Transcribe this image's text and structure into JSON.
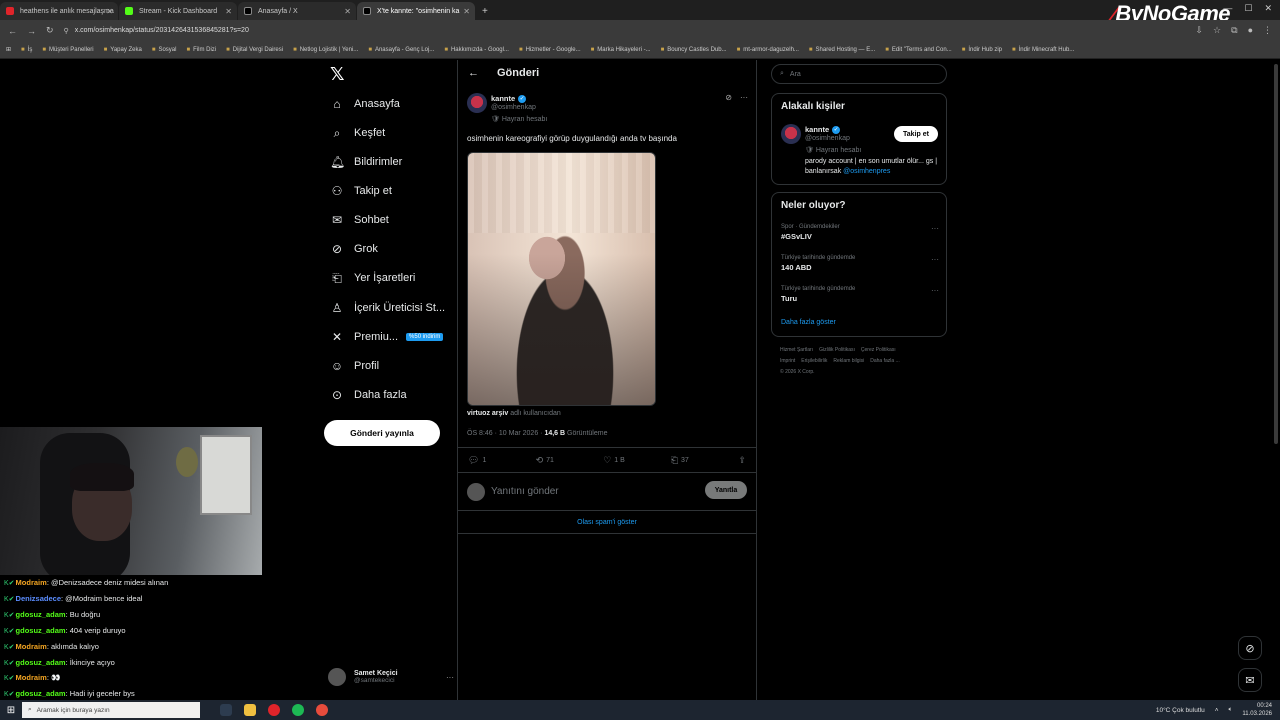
{
  "browser": {
    "tabs": [
      {
        "label": "heathens ile anlık mesajlaşma",
        "color": "#e0242a",
        "active": false
      },
      {
        "label": "Stream - Kick Dashboard",
        "color": "#53fc18",
        "active": false
      },
      {
        "label": "Anasayfa / X",
        "color": "#ffffff",
        "active": false
      },
      {
        "label": "X'te kannte: \"osimhenin ka",
        "color": "#ffffff",
        "active": true
      }
    ],
    "url": "x.com/osimhenkap/status/2031426431536845281?s=20",
    "bookmarks": [
      "İş",
      "Müşteri Panelleri",
      "Yapay Zeka",
      "Sosyal",
      "Film Dizi",
      "Dijital Vergi Dairesi",
      "Netlog Lojistik | Yeni...",
      "Anasayfa - Genç Loj...",
      "Hakkımızda - Googl...",
      "Hizmetler - Google...",
      "Marka Hikayeleri -...",
      "Bouncy Castles Dub...",
      "mt-armor-daguzelh...",
      "Shared Hosting — E...",
      "Edit \"Terms and Con...",
      "İndir Hub zip",
      "İndir Minecraft Hub..."
    ],
    "brand": {
      "prefix": "By",
      "suffix": "NoGame"
    }
  },
  "nav": {
    "items": [
      {
        "label": "Anasayfa",
        "icon": "home-icon",
        "glyph": "⌂"
      },
      {
        "label": "Keşfet",
        "icon": "search-icon",
        "glyph": "⌕"
      },
      {
        "label": "Bildirimler",
        "icon": "bell-icon",
        "glyph": "🔔︎"
      },
      {
        "label": "Takip et",
        "icon": "person-add-icon",
        "glyph": "⚇"
      },
      {
        "label": "Sohbet",
        "icon": "mail-icon",
        "glyph": "✉"
      },
      {
        "label": "Grok",
        "icon": "grok-icon",
        "glyph": "⊘"
      },
      {
        "label": "Yer İşaretleri",
        "icon": "bookmark-icon",
        "glyph": "⎗"
      },
      {
        "label": "İçerik Üreticisi St...",
        "icon": "creator-icon",
        "glyph": "♙"
      },
      {
        "label": "Premiu...",
        "icon": "x-icon",
        "glyph": "✕"
      },
      {
        "label": "Profil",
        "icon": "profile-icon",
        "glyph": "☺"
      },
      {
        "label": "Daha fazla",
        "icon": "more-icon",
        "glyph": "⊙"
      }
    ],
    "premium_badge": "%50 indirim",
    "post_button": "Gönderi yayınla",
    "account": {
      "name": "Samet Keçici",
      "handle": "@samtekecici"
    }
  },
  "post": {
    "header": "Gönderi",
    "author": {
      "name": "kannte",
      "handle": "@osimhenkap",
      "label": "Hayran hesabı"
    },
    "text": "osimhenin kareografiyi görüp duygulandığı anda tv başında",
    "source": {
      "name": "virtuoz arşiv",
      "suffix": "adlı kullanıcıdan"
    },
    "meta": {
      "time": "ÖS 8:46 · 10 Mar 2026 · ",
      "views": "14,6 B",
      "views_label": " Görüntüleme"
    },
    "actions": {
      "replies": "1",
      "reposts": "71",
      "likes": "1 B",
      "bookmarks": "37"
    },
    "reply_placeholder": "Yanıtını gönder",
    "reply_button": "Yanıtla",
    "spam_link": "Olası spam'i göster"
  },
  "sidebar": {
    "search_placeholder": "Ara",
    "related": {
      "title": "Alakalı kişiler",
      "name": "kannte",
      "handle": "@osimhenkap",
      "label": "Hayran hesabı",
      "bio": "parody account | en son umutlar ölür... gs | banlanırsak ",
      "mention": "@osimhenpres",
      "follow": "Takip et"
    },
    "trends": {
      "title": "Neler oluyor?",
      "items": [
        {
          "context": "Spor · Gündemdekiler",
          "topic": "#GSvLIV"
        },
        {
          "context": "Türkiye tarihinde gündemde",
          "topic": "140 ABD"
        },
        {
          "context": "Türkiye tarihinde gündemde",
          "topic": "Turu"
        }
      ],
      "show_more": "Daha fazla göster"
    },
    "footer": [
      "Hizmet Şartları",
      "Gizlilik Politikası",
      "Çerez Politikası",
      "Imprint",
      "Erişilebilirlik",
      "Reklam bilgisi",
      "Daha fazla ...",
      "© 2026 X Corp."
    ]
  },
  "chat": [
    {
      "user": "Modraim",
      "color": "#f5a623",
      "text": "@Denizsadece deniz midesi alınan"
    },
    {
      "user": "Denizsadece",
      "color": "#5b8dff",
      "text": "@Modraim bence ideal"
    },
    {
      "user": "gdosuz_adam",
      "color": "#53fc18",
      "text": "Bu doğru"
    },
    {
      "user": "gdosuz_adam",
      "color": "#53fc18",
      "text": "404 verip duruyo"
    },
    {
      "user": "Modraim",
      "color": "#f5a623",
      "text": "aklımda kalıyo"
    },
    {
      "user": "gdosuz_adam",
      "color": "#53fc18",
      "text": "İkinciye açıyo"
    },
    {
      "user": "Modraim",
      "color": "#f5a623",
      "text": "👀"
    },
    {
      "user": "gdosuz_adam",
      "color": "#53fc18",
      "text": "Hadi iyi geceler bys"
    }
  ],
  "taskbar": {
    "search": "Aramak için buraya yazın",
    "weather": "10°C  Çok bulutlu",
    "time": "00:24",
    "date": "11.03.2026"
  }
}
